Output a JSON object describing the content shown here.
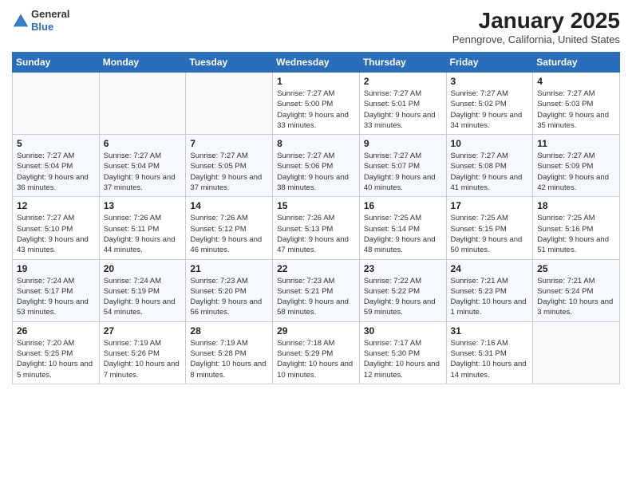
{
  "header": {
    "logo_general": "General",
    "logo_blue": "Blue",
    "month": "January 2025",
    "location": "Penngrove, California, United States"
  },
  "weekdays": [
    "Sunday",
    "Monday",
    "Tuesday",
    "Wednesday",
    "Thursday",
    "Friday",
    "Saturday"
  ],
  "weeks": [
    [
      {
        "day": "",
        "info": ""
      },
      {
        "day": "",
        "info": ""
      },
      {
        "day": "",
        "info": ""
      },
      {
        "day": "1",
        "info": "Sunrise: 7:27 AM\nSunset: 5:00 PM\nDaylight: 9 hours and 33 minutes."
      },
      {
        "day": "2",
        "info": "Sunrise: 7:27 AM\nSunset: 5:01 PM\nDaylight: 9 hours and 33 minutes."
      },
      {
        "day": "3",
        "info": "Sunrise: 7:27 AM\nSunset: 5:02 PM\nDaylight: 9 hours and 34 minutes."
      },
      {
        "day": "4",
        "info": "Sunrise: 7:27 AM\nSunset: 5:03 PM\nDaylight: 9 hours and 35 minutes."
      }
    ],
    [
      {
        "day": "5",
        "info": "Sunrise: 7:27 AM\nSunset: 5:04 PM\nDaylight: 9 hours and 36 minutes."
      },
      {
        "day": "6",
        "info": "Sunrise: 7:27 AM\nSunset: 5:04 PM\nDaylight: 9 hours and 37 minutes."
      },
      {
        "day": "7",
        "info": "Sunrise: 7:27 AM\nSunset: 5:05 PM\nDaylight: 9 hours and 37 minutes."
      },
      {
        "day": "8",
        "info": "Sunrise: 7:27 AM\nSunset: 5:06 PM\nDaylight: 9 hours and 38 minutes."
      },
      {
        "day": "9",
        "info": "Sunrise: 7:27 AM\nSunset: 5:07 PM\nDaylight: 9 hours and 40 minutes."
      },
      {
        "day": "10",
        "info": "Sunrise: 7:27 AM\nSunset: 5:08 PM\nDaylight: 9 hours and 41 minutes."
      },
      {
        "day": "11",
        "info": "Sunrise: 7:27 AM\nSunset: 5:09 PM\nDaylight: 9 hours and 42 minutes."
      }
    ],
    [
      {
        "day": "12",
        "info": "Sunrise: 7:27 AM\nSunset: 5:10 PM\nDaylight: 9 hours and 43 minutes."
      },
      {
        "day": "13",
        "info": "Sunrise: 7:26 AM\nSunset: 5:11 PM\nDaylight: 9 hours and 44 minutes."
      },
      {
        "day": "14",
        "info": "Sunrise: 7:26 AM\nSunset: 5:12 PM\nDaylight: 9 hours and 46 minutes."
      },
      {
        "day": "15",
        "info": "Sunrise: 7:26 AM\nSunset: 5:13 PM\nDaylight: 9 hours and 47 minutes."
      },
      {
        "day": "16",
        "info": "Sunrise: 7:25 AM\nSunset: 5:14 PM\nDaylight: 9 hours and 48 minutes."
      },
      {
        "day": "17",
        "info": "Sunrise: 7:25 AM\nSunset: 5:15 PM\nDaylight: 9 hours and 50 minutes."
      },
      {
        "day": "18",
        "info": "Sunrise: 7:25 AM\nSunset: 5:16 PM\nDaylight: 9 hours and 51 minutes."
      }
    ],
    [
      {
        "day": "19",
        "info": "Sunrise: 7:24 AM\nSunset: 5:17 PM\nDaylight: 9 hours and 53 minutes."
      },
      {
        "day": "20",
        "info": "Sunrise: 7:24 AM\nSunset: 5:19 PM\nDaylight: 9 hours and 54 minutes."
      },
      {
        "day": "21",
        "info": "Sunrise: 7:23 AM\nSunset: 5:20 PM\nDaylight: 9 hours and 56 minutes."
      },
      {
        "day": "22",
        "info": "Sunrise: 7:23 AM\nSunset: 5:21 PM\nDaylight: 9 hours and 58 minutes."
      },
      {
        "day": "23",
        "info": "Sunrise: 7:22 AM\nSunset: 5:22 PM\nDaylight: 9 hours and 59 minutes."
      },
      {
        "day": "24",
        "info": "Sunrise: 7:21 AM\nSunset: 5:23 PM\nDaylight: 10 hours and 1 minute."
      },
      {
        "day": "25",
        "info": "Sunrise: 7:21 AM\nSunset: 5:24 PM\nDaylight: 10 hours and 3 minutes."
      }
    ],
    [
      {
        "day": "26",
        "info": "Sunrise: 7:20 AM\nSunset: 5:25 PM\nDaylight: 10 hours and 5 minutes."
      },
      {
        "day": "27",
        "info": "Sunrise: 7:19 AM\nSunset: 5:26 PM\nDaylight: 10 hours and 7 minutes."
      },
      {
        "day": "28",
        "info": "Sunrise: 7:19 AM\nSunset: 5:28 PM\nDaylight: 10 hours and 8 minutes."
      },
      {
        "day": "29",
        "info": "Sunrise: 7:18 AM\nSunset: 5:29 PM\nDaylight: 10 hours and 10 minutes."
      },
      {
        "day": "30",
        "info": "Sunrise: 7:17 AM\nSunset: 5:30 PM\nDaylight: 10 hours and 12 minutes."
      },
      {
        "day": "31",
        "info": "Sunrise: 7:16 AM\nSunset: 5:31 PM\nDaylight: 10 hours and 14 minutes."
      },
      {
        "day": "",
        "info": ""
      }
    ]
  ]
}
